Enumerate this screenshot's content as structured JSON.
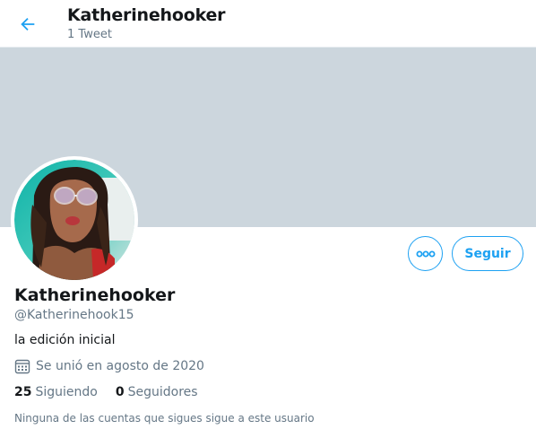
{
  "header": {
    "title": "Katherinehooker",
    "subtitle": "1 Tweet",
    "back_icon": "arrow-left-icon"
  },
  "colors": {
    "accent": "#1da1f2",
    "banner": "#ccd6dd",
    "secondary_text": "#657786"
  },
  "profile": {
    "display_name": "Katherinehooker",
    "handle": "@Katherinehook15",
    "bio": "la edición inicial",
    "joined": "Se unió en agosto de 2020",
    "joined_icon": "calendar-icon",
    "following_count": "25",
    "following_label": "Siguiendo",
    "followers_count": "0",
    "followers_label": "Seguidores",
    "followers_you_know": "Ninguna de las cuentas que sigues sigue a este usuario"
  },
  "actions": {
    "more_icon": "more-dots-icon",
    "follow_label": "Seguir"
  }
}
